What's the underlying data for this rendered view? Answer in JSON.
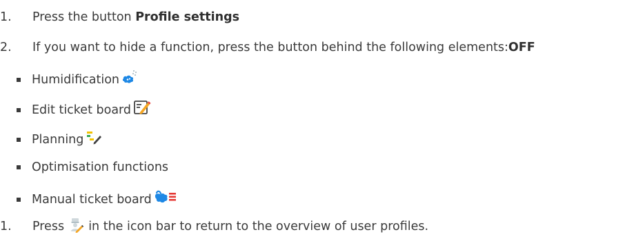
{
  "steps": {
    "step1": {
      "number": "1.",
      "text": "Press the button ",
      "bold": "Profile settings"
    },
    "step2": {
      "number": "2.",
      "text": "If you want to hide a function, press the button behind the following elements:",
      "bold": "OFF"
    },
    "step3": {
      "number": "1.",
      "text_before": "Press ",
      "text_after": " in the icon bar to return to the overview of user profiles.",
      "icon": "user-profile-edit-icon"
    }
  },
  "bullets": [
    {
      "label": "Humidification",
      "icon": "humidification-icon"
    },
    {
      "label": "Edit ticket board",
      "icon": "edit-ticket-board-icon"
    },
    {
      "label": "Planning",
      "icon": "planning-icon"
    },
    {
      "label": "Optimisation functions",
      "icon": ""
    },
    {
      "label": "Manual ticket board",
      "icon": "manual-ticket-board-icon"
    }
  ],
  "colors": {
    "text": "#3a3a3a",
    "icon_blue": "#1e88e5",
    "icon_yellow": "#f2c200",
    "icon_green": "#34a853",
    "icon_red": "#e53935",
    "icon_orange": "#f5a623"
  }
}
